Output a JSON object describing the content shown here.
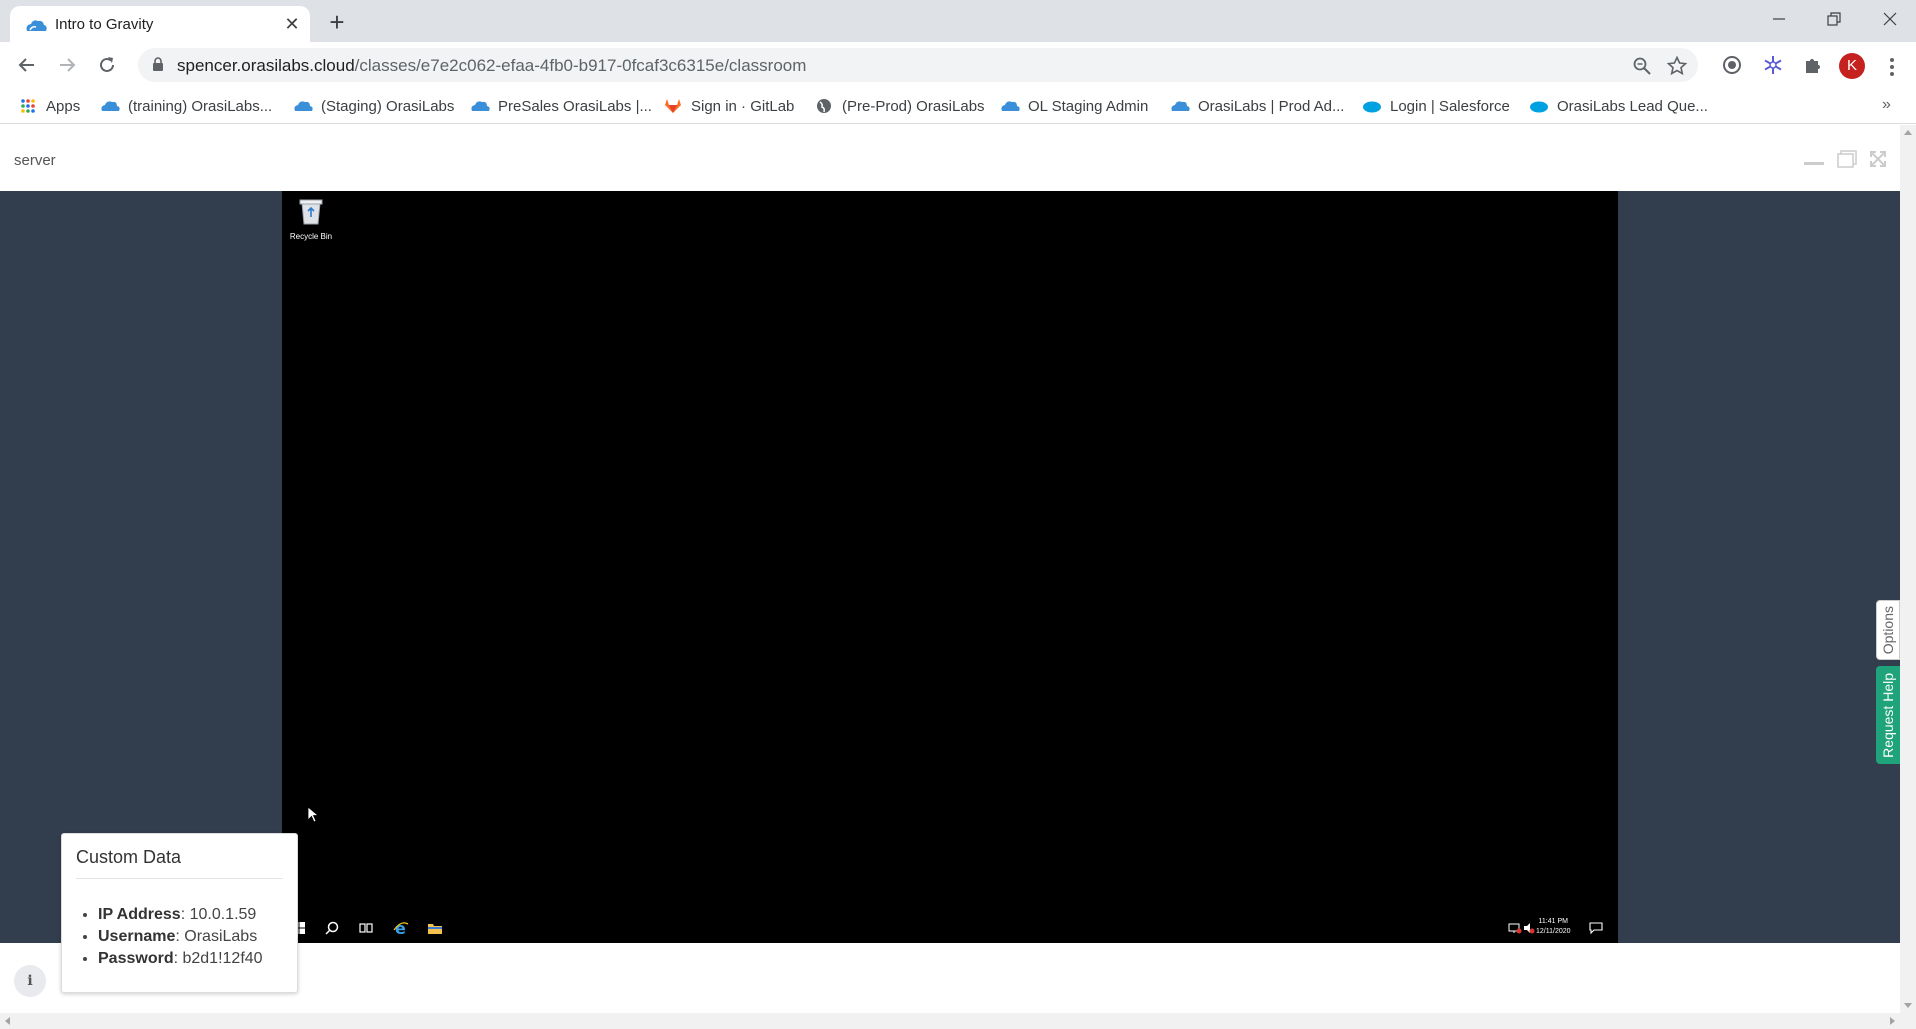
{
  "browser": {
    "tab": {
      "title": "Intro to Gravity"
    },
    "address": {
      "host": "spencer.orasilabs.cloud",
      "path": "/classes/e7e2c062-efaa-4fb0-b917-0fcaf3c6315e/classroom"
    },
    "profile_initial": "K",
    "bookmarks": [
      {
        "label": "Apps",
        "icon": "apps-grid-icon"
      },
      {
        "label": "(training) OrasiLabs...",
        "icon": "cloud-icon"
      },
      {
        "label": "(Staging) OrasiLabs",
        "icon": "cloud-icon"
      },
      {
        "label": "PreSales OrasiLabs |...",
        "icon": "cloud-icon"
      },
      {
        "label": "Sign in · GitLab",
        "icon": "gitlab-icon"
      },
      {
        "label": "(Pre-Prod) OrasiLabs",
        "icon": "globe-icon"
      },
      {
        "label": "OL Staging Admin",
        "icon": "cloud-icon"
      },
      {
        "label": "OrasiLabs | Prod Ad...",
        "icon": "cloud-icon"
      },
      {
        "label": "Login | Salesforce",
        "icon": "salesforce-icon"
      },
      {
        "label": "OrasiLabs Lead Que...",
        "icon": "salesforce-icon"
      }
    ],
    "bookmarks_more": "»"
  },
  "panel": {
    "title": "server"
  },
  "desktop": {
    "recycle_bin_label": "Recycle Bin",
    "clock_time": "11:41 PM",
    "clock_date": "12/11/2020"
  },
  "custom_data": {
    "title": "Custom Data",
    "items": [
      {
        "key": "IP Address",
        "value": ": 10.0.1.59"
      },
      {
        "key": "Username",
        "value": ": OrasiLabs"
      },
      {
        "key": "Password",
        "value": ": b2d1!12f40"
      }
    ]
  },
  "side_tabs": {
    "options": "Options",
    "request_help": "Request Help"
  },
  "info_button": "i",
  "colors": {
    "stage_bg": "#323e4e",
    "help_tab": "#1fa37a",
    "avatar": "#c5221f"
  }
}
